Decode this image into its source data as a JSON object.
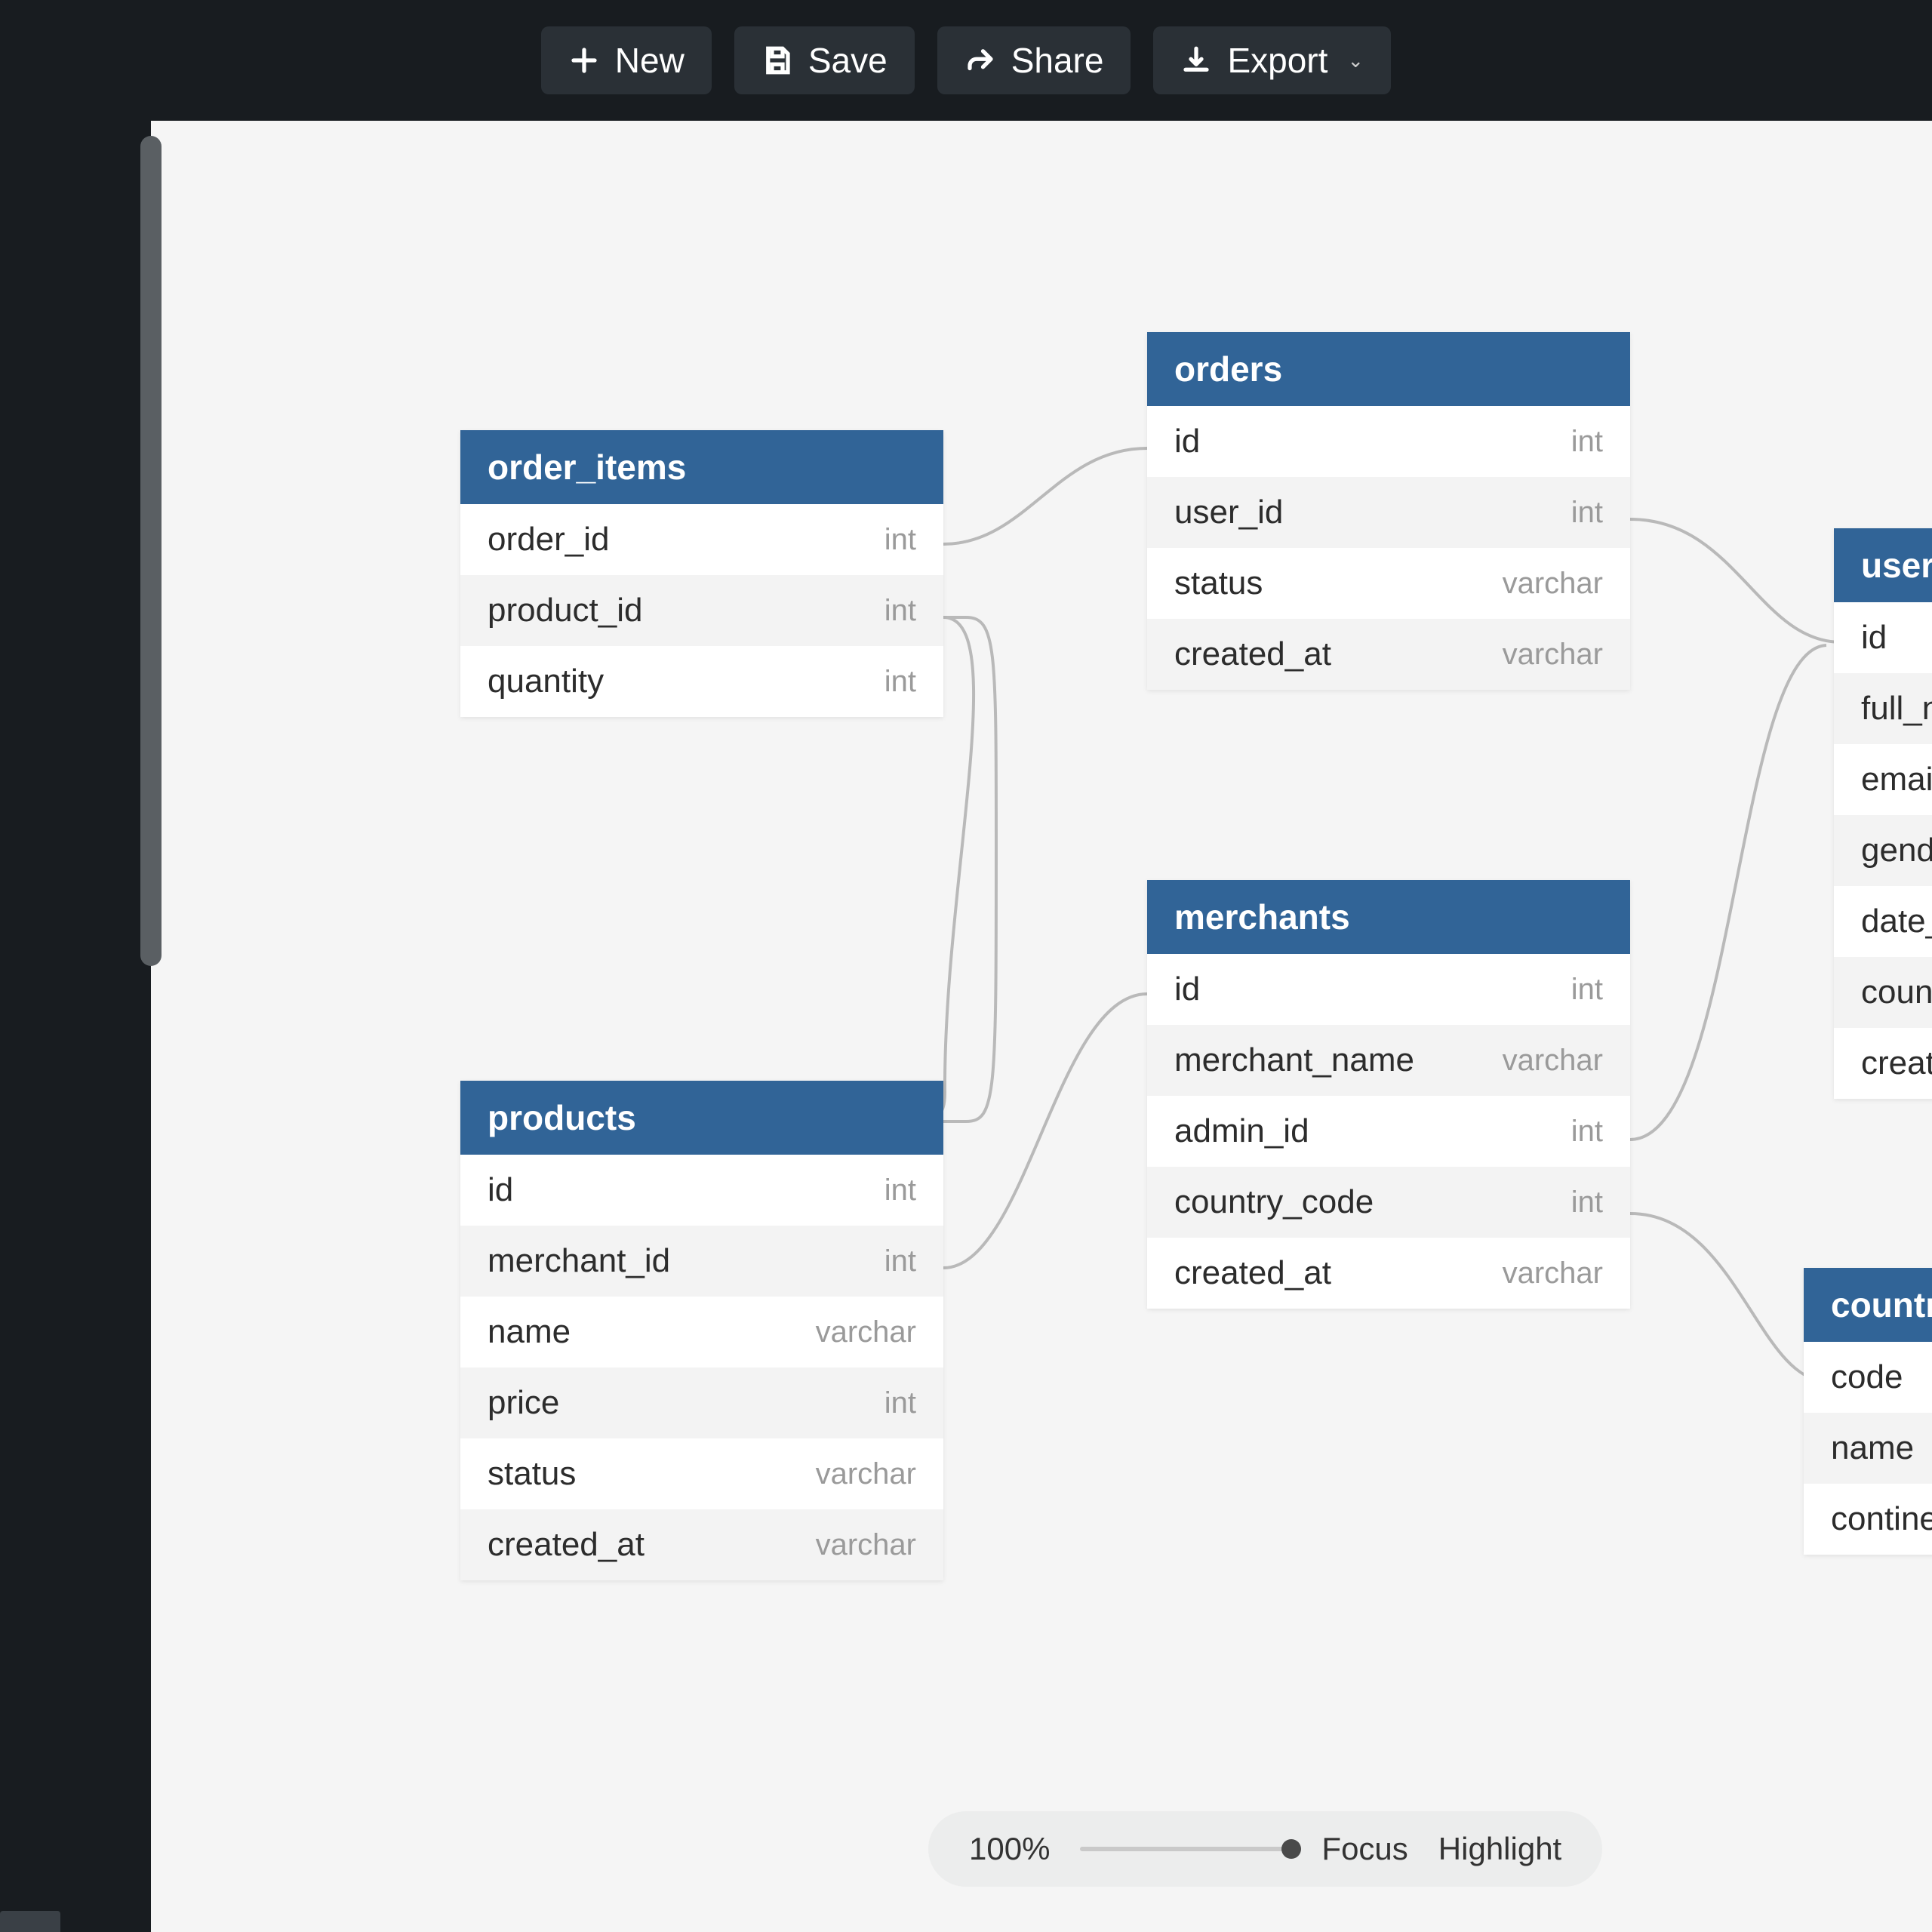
{
  "toolbar": {
    "new_label": "New",
    "save_label": "Save",
    "share_label": "Share",
    "export_label": "Export"
  },
  "zoom": {
    "percent_label": "100%",
    "slider_value": 100,
    "focus_label": "Focus",
    "highlight_label": "Highlight"
  },
  "tables": {
    "order_items": {
      "title": "order_items",
      "rows": [
        {
          "col": "order_id",
          "type": "int"
        },
        {
          "col": "product_id",
          "type": "int"
        },
        {
          "col": "quantity",
          "type": "int"
        }
      ]
    },
    "orders": {
      "title": "orders",
      "rows": [
        {
          "col": "id",
          "type": "int"
        },
        {
          "col": "user_id",
          "type": "int"
        },
        {
          "col": "status",
          "type": "varchar"
        },
        {
          "col": "created_at",
          "type": "varchar"
        }
      ]
    },
    "products": {
      "title": "products",
      "rows": [
        {
          "col": "id",
          "type": "int"
        },
        {
          "col": "merchant_id",
          "type": "int"
        },
        {
          "col": "name",
          "type": "varchar"
        },
        {
          "col": "price",
          "type": "int"
        },
        {
          "col": "status",
          "type": "varchar"
        },
        {
          "col": "created_at",
          "type": "varchar"
        }
      ]
    },
    "merchants": {
      "title": "merchants",
      "rows": [
        {
          "col": "id",
          "type": "int"
        },
        {
          "col": "merchant_name",
          "type": "varchar"
        },
        {
          "col": "admin_id",
          "type": "int"
        },
        {
          "col": "country_code",
          "type": "int"
        },
        {
          "col": "created_at",
          "type": "varchar"
        }
      ]
    },
    "users": {
      "title": "users",
      "rows": [
        {
          "col": "id",
          "type": ""
        },
        {
          "col": "full_name",
          "type": ""
        },
        {
          "col": "email",
          "type": ""
        },
        {
          "col": "gender",
          "type": ""
        },
        {
          "col": "date_joined",
          "type": ""
        },
        {
          "col": "country_code",
          "type": ""
        },
        {
          "col": "created_at",
          "type": ""
        }
      ]
    },
    "countries": {
      "title": "countries",
      "rows": [
        {
          "col": "code",
          "type": ""
        },
        {
          "col": "name",
          "type": ""
        },
        {
          "col": "continent",
          "type": ""
        }
      ]
    }
  }
}
